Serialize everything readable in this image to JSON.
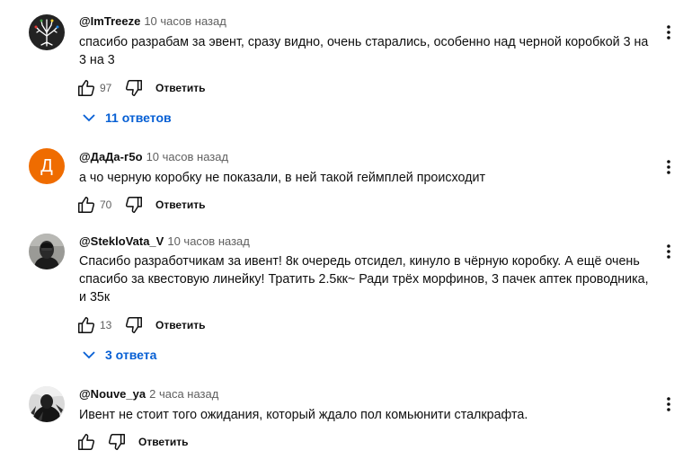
{
  "comments": [
    {
      "author": "@ImTreeze",
      "time": "10 часов назад",
      "text": "спасибо разрабам за эвент, сразу видно, очень старались, особенно над черной коробкой 3 на 3 на 3",
      "likes": "97",
      "reply_label": "Ответить",
      "replies_label": "11 ответов",
      "avatar_icon": "tree-avatar-icon"
    },
    {
      "author": "@ДаДа-г5о",
      "time": "10 часов назад",
      "text": "а чо черную коробку не показали, в ней такой геймплей происходит",
      "likes": "70",
      "reply_label": "Ответить",
      "avatar_letter": "Д",
      "avatar_color": "#ef6c00"
    },
    {
      "author": "@StekloVata_V",
      "time": "10 часов назад",
      "text": "Спасибо разработчикам за ивент! 8к очередь отсидел, кинуло в чёрную коробку. А ещё очень спасибо за квестовую линейку! Тратить 2.5кк~ Ради трёх морфинов, 3 пачек аптек проводника, и 35к",
      "likes": "13",
      "reply_label": "Ответить",
      "replies_label": "3 ответа",
      "avatar_icon": "masked-person-avatar-icon"
    },
    {
      "author": "@Nouve_ya",
      "time": "2 часа назад",
      "text": "Ивент не стоит того ожидания, который ждало пол комьюнити сталкрафта.",
      "likes": "",
      "reply_label": "Ответить",
      "avatar_icon": "dark-figure-avatar-icon"
    }
  ],
  "colors": {
    "link_blue": "#065fd4",
    "text_primary": "#0f0f0f",
    "text_secondary": "#606060"
  }
}
